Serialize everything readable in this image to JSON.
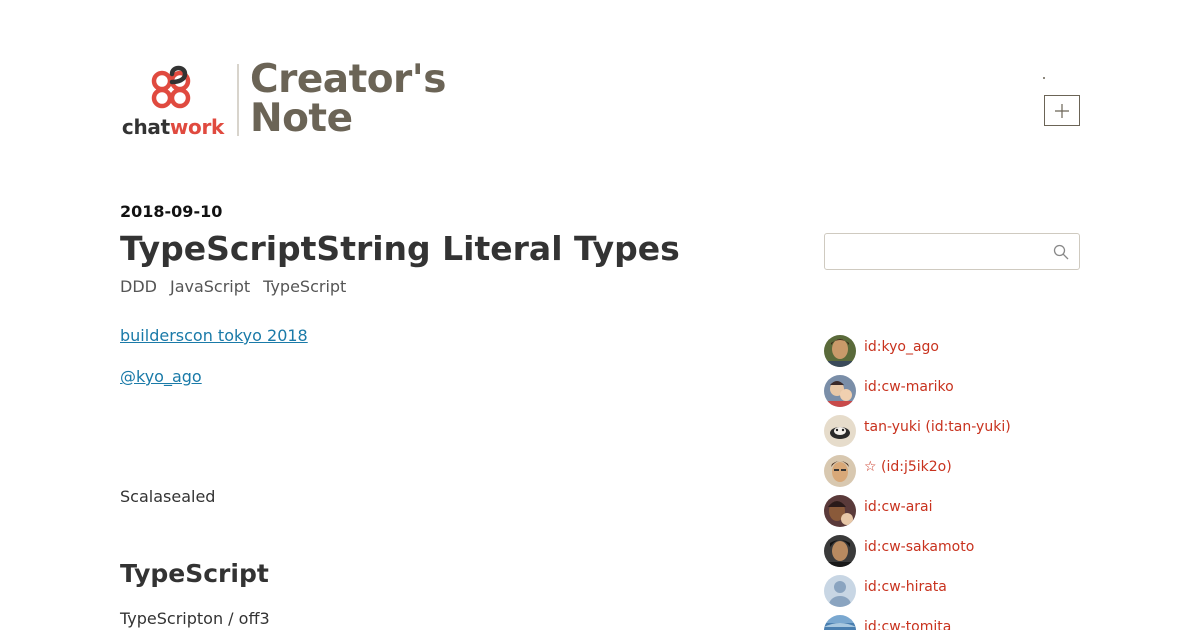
{
  "brand": {
    "logo_word_part1": "chat",
    "logo_word_part2": "work",
    "title_line1": "Creator's",
    "title_line2": "Note",
    "accent_color": "#e04a3f",
    "title_color": "#6b6456"
  },
  "header": {
    "add_button_icon": "plus-icon"
  },
  "article": {
    "date": "2018-09-10",
    "title": "TypeScriptString Literal Types",
    "tags": [
      "DDD",
      "JavaScript",
      "TypeScript"
    ],
    "links": [
      "builderscon tokyo 2018",
      "@kyo_ago"
    ],
    "paragraph_1": "Scalasealed",
    "section_heading": "TypeScript",
    "paragraph_2": "TypeScripton / off3"
  },
  "search": {
    "placeholder": "",
    "icon": "search-icon"
  },
  "authors": [
    {
      "name": "id:kyo_ago",
      "avatar_color": "#7a5a2e"
    },
    {
      "name": "id:cw-mariko",
      "avatar_color": "#5b6f8a"
    },
    {
      "name": "tan-yuki (id:tan-yuki)",
      "avatar_color": "#d9cbb3"
    },
    {
      "name": "☆ (id:j5ik2o)",
      "avatar_color": "#8a6a4e"
    },
    {
      "name": "id:cw-arai",
      "avatar_color": "#6b4a3a"
    },
    {
      "name": "id:cw-sakamoto",
      "avatar_color": "#2f2f2f"
    },
    {
      "name": "id:cw-hirata",
      "avatar_color": "#9fb3c8"
    },
    {
      "name": "id:cw-tomita",
      "avatar_color": "#4a7fb0"
    }
  ],
  "colors": {
    "link": "#1a7aa8",
    "author_link": "#c8321e"
  }
}
